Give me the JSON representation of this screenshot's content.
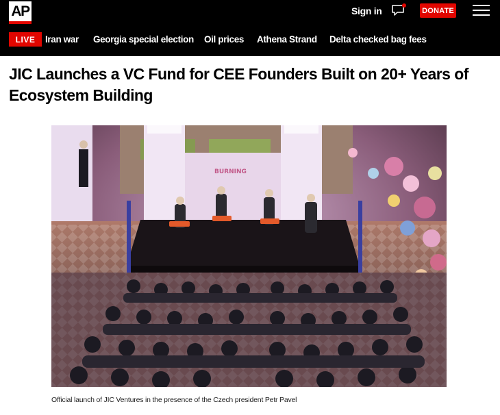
{
  "header": {
    "logo_text": "AP",
    "signin_label": "Sign in",
    "donate_label": "DONATE",
    "chat_icon": "chat-bubble-icon",
    "menu_icon": "hamburger-menu-icon"
  },
  "nav": {
    "live_label": "LIVE",
    "items": [
      "Iran war",
      "Georgia special election",
      "Oil prices",
      "Athena Strand",
      "Delta checked bag fees"
    ]
  },
  "article": {
    "headline": "JIC Launches a VC Fund for CEE Founders Built on 20+ Years of Ecosystem Building",
    "photo_caption": "Official launch of JIC Ventures in the presence of the Czech president Petr Pavel"
  },
  "colors": {
    "brand_red": "#e10600",
    "header_bg": "#000000"
  }
}
